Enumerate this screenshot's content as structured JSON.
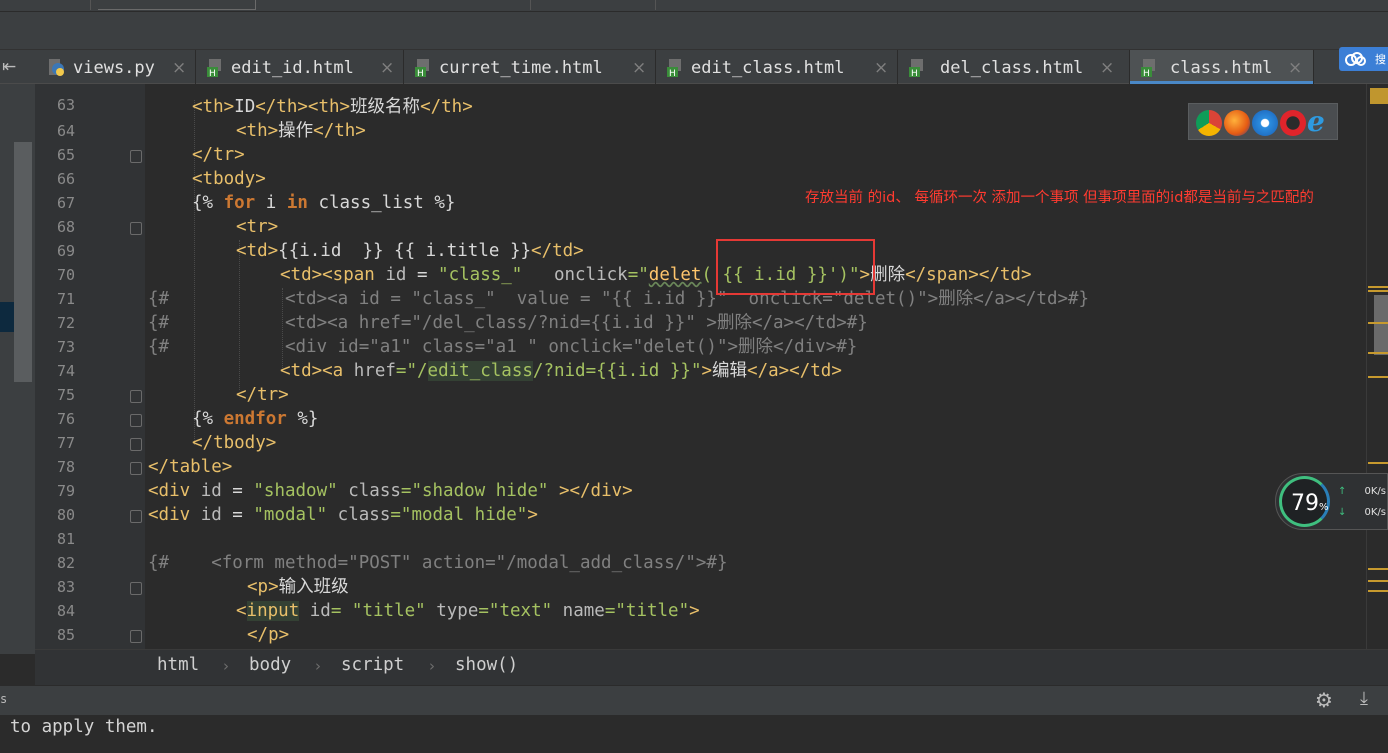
{
  "tabs": [
    {
      "label": "views.py",
      "icon": "python-file-icon",
      "active": false
    },
    {
      "label": "edit_id.html",
      "icon": "html-file-icon",
      "active": false
    },
    {
      "label": "curret_time.html",
      "icon": "html-file-icon",
      "active": false
    },
    {
      "label": "edit_class.html",
      "icon": "html-file-icon",
      "active": false
    },
    {
      "label": "del_class.html",
      "icon": "html-file-icon",
      "active": false
    },
    {
      "label": "class.html",
      "icon": "html-file-icon",
      "active": true
    }
  ],
  "close_glyph": "×",
  "collapse_glyph": "⇤",
  "badge_text": "搜",
  "line_numbers": [
    "63",
    "64",
    "65",
    "66",
    "67",
    "68",
    "69",
    "70",
    "71",
    "72",
    "73",
    "74",
    "75",
    "76",
    "77",
    "78",
    "79",
    "80",
    "81",
    "82",
    "83",
    "84",
    "85"
  ],
  "code": {
    "l63_open": "<th>",
    "l63_a": "ID",
    "l63_b": "</th><th>",
    "l63_c": "班级名称",
    "l63_d": "</th>",
    "l64_open": "<th>",
    "l64_a": "操作",
    "l64_close": "</th>",
    "l65": "</tr>",
    "l66": "<tbody>",
    "l67_a": "{% ",
    "l67_for": "for",
    "l67_b": " i ",
    "l67_in": "in",
    "l67_c": " class_list %}",
    "l68": "<tr>",
    "l69_open": "<td>",
    "l69_a": "{{i.id  }} {{ i.title }}",
    "l69_close": "</td>",
    "l70_a": "<td><span ",
    "l70_b": "id",
    "l70_c": " = ",
    "l70_d": "\"class_\"",
    "l70_e": "   onclick",
    "l70_f": "=\"",
    "l70_g": "delet",
    "l70_h": "('{{ i.id }}')",
    "l70_i": "\"",
    "l70_j": ">",
    "l70_k": "删除",
    "l70_l": "</span></td>",
    "l71": "{#           <td><a id = \"class_\"  value = \"{{ i.id }}\"  onclick=\"delet()\">删除</a></td>#}",
    "l72": "{#           <td><a href=\"/del_class/?nid={{i.id }}\" >删除</a></td>#}",
    "l73": "{#           <div id=\"a1\" class=\"a1 \" onclick=\"delet()\">删除</div>#}",
    "l74_a": "<td><a ",
    "l74_b": "href",
    "l74_c": "=",
    "l74_d": "\"/",
    "l74_e": "edit_class",
    "l74_f": "/?nid={{i.id }}\"",
    "l74_g": ">",
    "l74_h": "编辑",
    "l74_i": "</a></td>",
    "l75": "</tr>",
    "l76_a": "{% ",
    "l76_k": "endfor",
    "l76_b": " %}",
    "l77": "</tbody>",
    "l78": "</table>",
    "l79_a": "<div ",
    "l79_b": "id",
    "l79_c": " = ",
    "l79_d": "\"shadow\"",
    "l79_e": " class",
    "l79_f": "=",
    "l79_g": "\"shadow hide\"",
    "l79_h": " ></div>",
    "l80_a": "<div ",
    "l80_b": "id",
    "l80_c": " = ",
    "l80_d": "\"modal\"",
    "l80_e": " class",
    "l80_f": "=",
    "l80_g": "\"modal hide\"",
    "l80_h": ">",
    "l82": "{#    <form method=\"POST\" action=\"/modal_add_class/\">#}",
    "l83_a": "<p>",
    "l83_b": "输入班级",
    "l84_a": "<",
    "l84_b": "input",
    "l84_c": " id",
    "l84_d": "= ",
    "l84_e": "\"title\"",
    "l84_f": " type",
    "l84_g": "=",
    "l84_h": "\"text\"",
    "l84_i": " name",
    "l84_j": "=",
    "l84_k": "\"title\"",
    "l84_l": ">",
    "l85": "</p>"
  },
  "annotation_note": "存放当前 的id、 每循环一次 添加一个事项 但事项里面的id都是当前与之匹配的",
  "browser_icons": [
    "chrome-icon",
    "firefox-icon",
    "safari-icon",
    "opera-icon",
    "ie-icon"
  ],
  "network_widget": {
    "percent": "79",
    "percent_sign": "%",
    "upload": "0K/s",
    "download": "0K/s",
    "up_arrow": "↑",
    "down_arrow": "↓"
  },
  "breadcrumb": [
    "html",
    "body",
    "script",
    "show()"
  ],
  "breadcrumb_sep": "›",
  "bottom_left_glyph": "s",
  "status_message": "to apply them.",
  "gear_glyph": "⚙",
  "download_glyph": "⤓",
  "colors": {
    "tag": "#e8bf6a",
    "string": "#a5c261",
    "keyword": "#cc7832",
    "comment": "#808080",
    "accent": "#4a88c7",
    "annotation": "#ff3b30"
  }
}
